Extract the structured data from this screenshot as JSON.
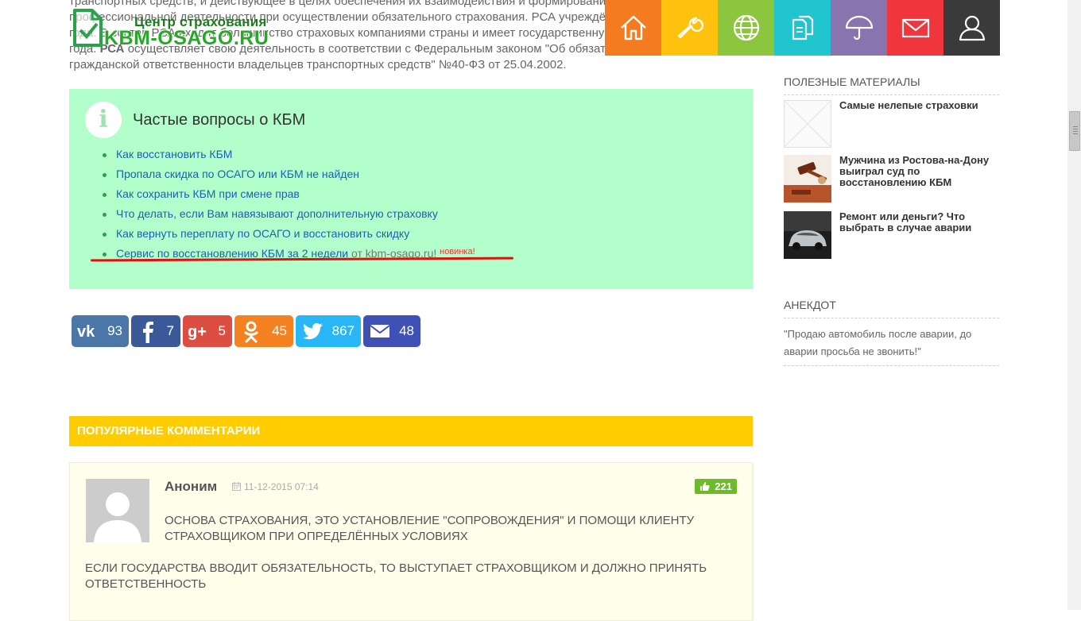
{
  "article": {
    "line1": "транспортных средств, и действующее в целях обеспечения их взаимодействия и формирования правил",
    "line2": "профессиональной деятельности при осуществлении обязательного страхования. РСА учреждён",
    "line3": "года. В состав РСА входит большинство страховых компаниями страны и имеет государственную регистрацию",
    "line4_prefix": "года.",
    "line4_bold": "РСА",
    "line4_rest": "осуществляет свою деятельность в соответствии с Федеральным законом \"Об обязательном страховании",
    "line5": "гражданской ответственности владельцев транспортных средств\" №40-ФЗ от 25.04.2002."
  },
  "logo": {
    "line1": "Центр страхования",
    "line2": "KBM-OSAGO.RU"
  },
  "nav": [
    {
      "name": "home",
      "color": "#f47b20",
      "icon": "home-icon"
    },
    {
      "name": "tools",
      "color": "#ffc20e",
      "icon": "wrench-icon"
    },
    {
      "name": "web",
      "color": "#8cc63f",
      "icon": "globe-icon"
    },
    {
      "name": "docs",
      "color": "#21c5d0",
      "icon": "documents-icon"
    },
    {
      "name": "insurance",
      "color": "#8a74b0",
      "icon": "umbrella-icon"
    },
    {
      "name": "mail",
      "color": "#f1353d",
      "icon": "mail-icon"
    },
    {
      "name": "user",
      "color": "#3a3a3a",
      "icon": "user-icon"
    }
  ],
  "faq": {
    "title": "Частые вопросы о КБМ",
    "items": [
      "Как восстановить КБМ",
      "Пропала скидка по ОСАГО или КБМ не найден",
      "Как сохранить КБМ при смене прав",
      "Что делать, если Вам навязывают дополнительную страховку",
      "Как вернуть переплату по ОСАГО и восстановить скидку"
    ],
    "last_link": "Сервис по восстановлению КБМ за 2 недели",
    "last_from": "от kbm-osago.ru!",
    "last_badge": "новинка!"
  },
  "share": [
    {
      "network": "vk",
      "count": "93",
      "color": "#4a76a8",
      "icon": "vk-icon"
    },
    {
      "network": "facebook",
      "count": "7",
      "color": "#3b5998",
      "icon": "facebook-icon"
    },
    {
      "network": "googleplus",
      "count": "5",
      "color": "#dc4e41",
      "icon": "googleplus-icon"
    },
    {
      "network": "odnoklassniki",
      "count": "45",
      "color": "#f58220",
      "icon": "odnoklassniki-icon"
    },
    {
      "network": "twitter",
      "count": "867",
      "color": "#29b6f6",
      "icon": "twitter-icon"
    },
    {
      "network": "email",
      "count": "48",
      "color": "#3f51b5",
      "icon": "email-icon"
    }
  ],
  "popular": {
    "header": "ПОПУЛЯРНЫЕ КОММЕНТАРИИ",
    "comment": {
      "author": "Аноним",
      "date": "11-12-2015 07:14",
      "likes": "221",
      "text1": "ОСНОВА СТРАХОВАНИЯ, ЭТО УСТАНОВЛЕНИЕ \"СОПРОВОЖДЕНИЯ\" И ПОМОЩИ КЛИЕНТУ СТРАХОВЩИКОМ ПРИ ОПРЕДЕЛЁННЫХ УСЛОВИЯХ",
      "text2": "ЕСЛИ ГОСУДАРСТВА ВВОДИТ ОБЯЗАТЕЛЬНОСТЬ, ТО ВЫСТУПАЕТ СТРАХОВЩИКОМ И ДОЛЖНО ПРИНЯТЬ ОТВЕТСТВЕННОСТЬ"
    }
  },
  "sidebar": {
    "useful_title": "ПОЛЕЗНЫЕ МАТЕРИАЛЫ",
    "useful_items": [
      "Самые нелепые страховки",
      "Мужчина из Ростова-на-Дону выиграл суд по восстановлению КБМ",
      "Ремонт или деньги? Что выбрать в случае аварии"
    ],
    "joke_title": "АНЕКДОТ",
    "joke_text": "\"Продаю автомобиль после аварии, до аварии просьба не звонить!\""
  }
}
